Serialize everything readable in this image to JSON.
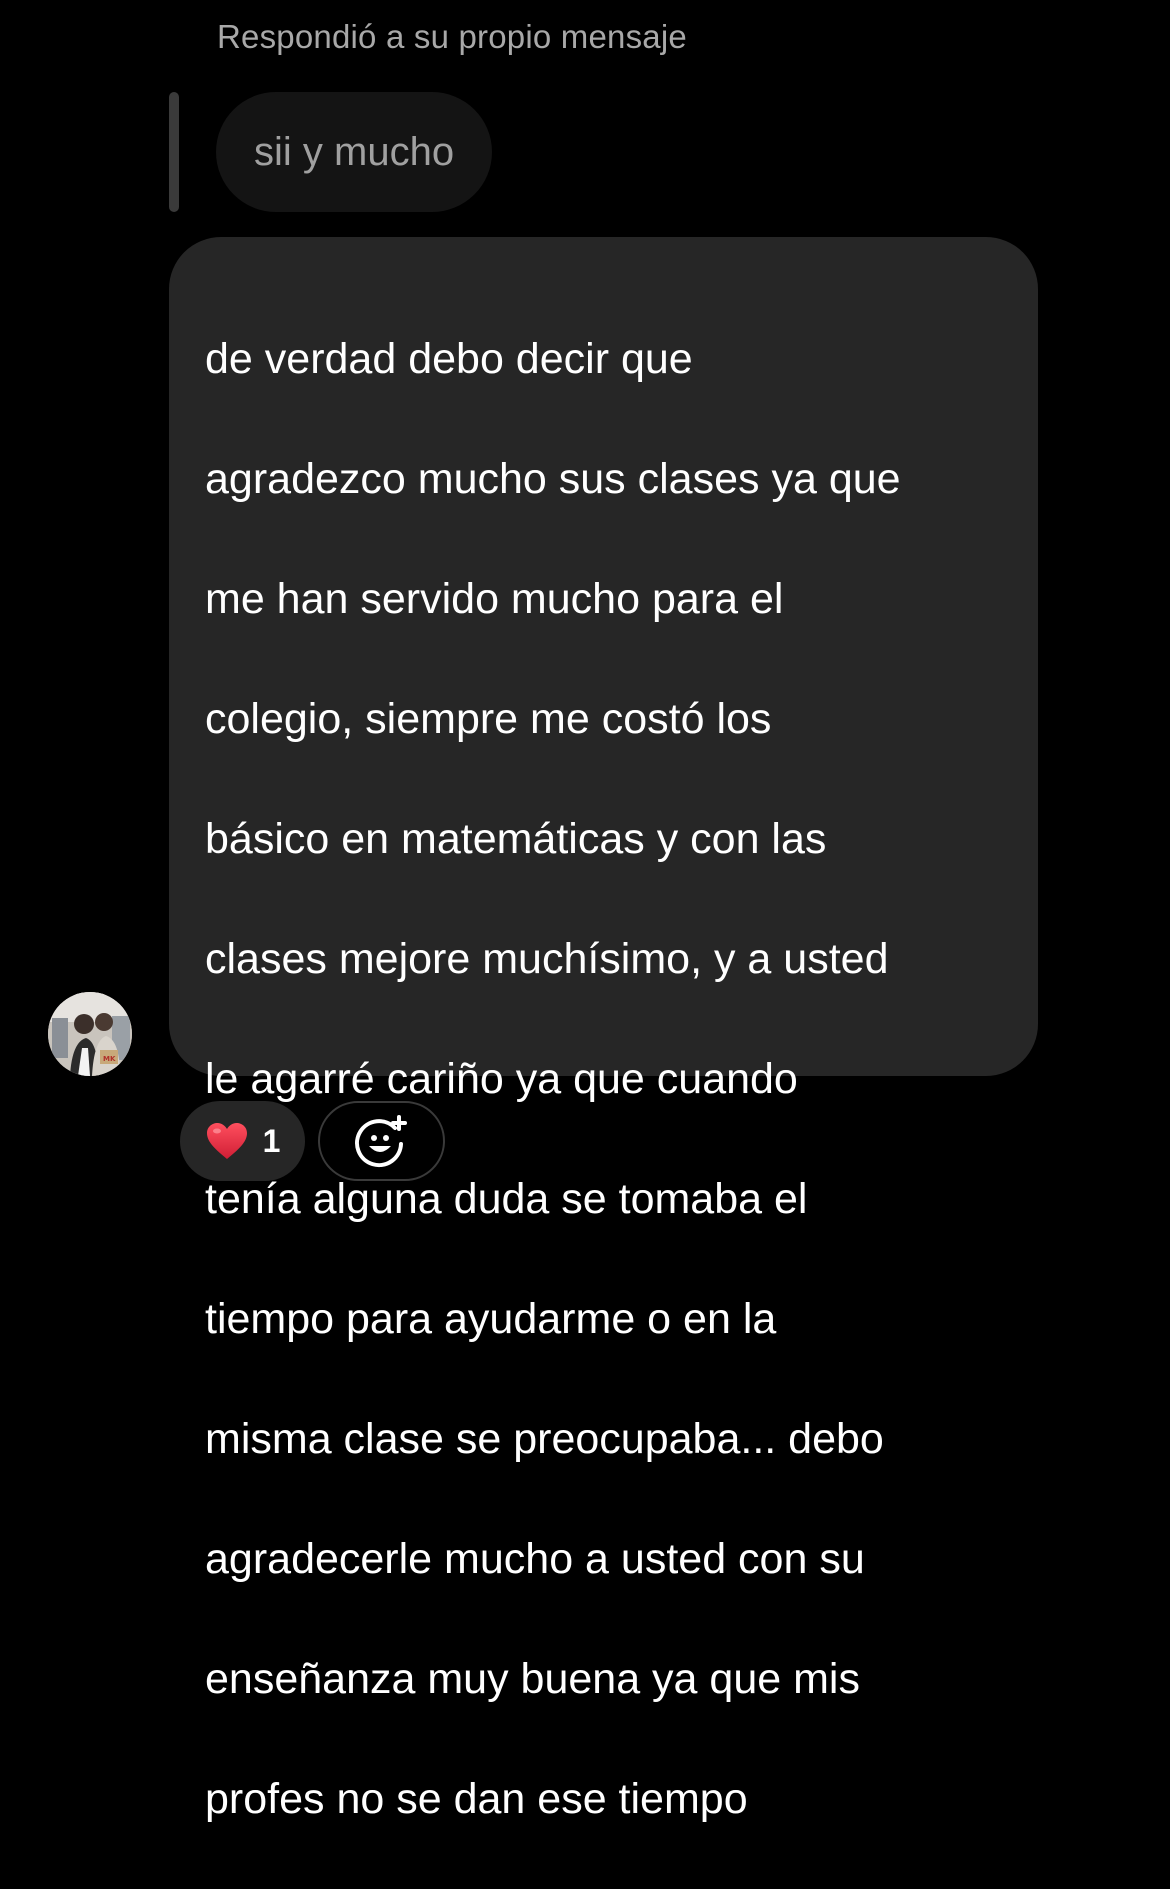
{
  "reply_header": {
    "caption": "Respondió a su propio mensaje",
    "quoted_message": "sii y mucho"
  },
  "message": {
    "lines": [
      "de verdad debo decir que",
      "agradezco mucho sus clases ya que",
      "me han servido mucho para el",
      "colegio, siempre me costó los",
      "básico en matemáticas y con las",
      "clases mejore muchísimo, y a usted",
      "le agarré cariño ya que cuando",
      "tenía alguna duda se tomaba el",
      "tiempo para ayudarme o en la",
      "misma clase se preocupaba... debo",
      "agradecerle mucho a usted con su",
      "enseñanza muy buena ya que mis",
      "profes no se dan ese tiempo"
    ]
  },
  "reactions": {
    "emoji_icon": "red-heart-icon",
    "count": "1",
    "add_reaction_icon": "smiley-plus-icon"
  },
  "colors": {
    "background": "#000000",
    "bubble": "#262626",
    "quoted_bubble": "#141414",
    "caption": "#a8a8a8",
    "heart": "#e0245e"
  }
}
